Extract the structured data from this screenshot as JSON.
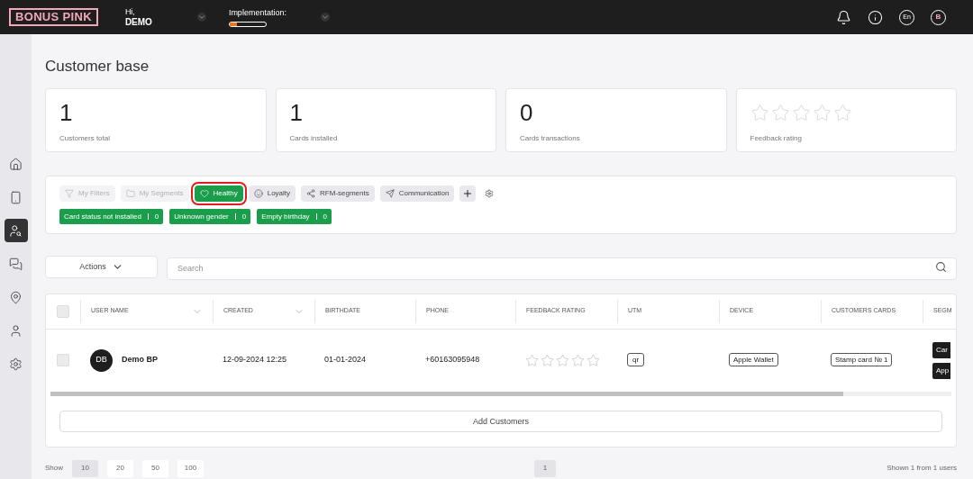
{
  "header": {
    "logo": "BONUS PINK",
    "greeting": "Hi,",
    "user": "DEMO",
    "implementation": {
      "label": "Implementation:",
      "level": 0.2
    },
    "language": "En",
    "avatar": "B"
  },
  "sidebar": {
    "items": [
      {
        "selected": false
      },
      {
        "selected": false
      },
      {
        "selected": true
      },
      {
        "selected": false
      },
      {
        "selected": false
      },
      {
        "selected": false
      },
      {
        "selected": false
      }
    ]
  },
  "page_title": "Customer base",
  "stats": [
    {
      "kind": "number",
      "value": "1",
      "label": "Customers total"
    },
    {
      "kind": "number",
      "value": "1",
      "label": "Cards installed"
    },
    {
      "kind": "number",
      "value": "0",
      "label": "Cards transactions"
    },
    {
      "kind": "stars",
      "stars": 0,
      "label": "Feedback rating"
    }
  ],
  "filter_tabs": [
    {
      "label": "My Filters",
      "selected": false,
      "disabled": true,
      "highlighted": false
    },
    {
      "label": "My Segments",
      "selected": false,
      "disabled": true,
      "highlighted": false
    },
    {
      "label": "Healthy",
      "selected": true,
      "disabled": false,
      "highlighted": true
    },
    {
      "label": "Loyalty",
      "selected": false,
      "disabled": false,
      "highlighted": false
    },
    {
      "label": "RFM-segments",
      "selected": false,
      "disabled": false,
      "highlighted": false
    },
    {
      "label": "Communication",
      "selected": false,
      "disabled": false,
      "highlighted": false
    }
  ],
  "segments": [
    {
      "label": "Card status not installed",
      "count": "0"
    },
    {
      "label": "Unknown gender",
      "count": "0"
    },
    {
      "label": "Empty birthday",
      "count": "0"
    }
  ],
  "actions_button": "Actions",
  "search": {
    "placeholder": "Search"
  },
  "table": {
    "select_all": {
      "checked": false
    },
    "columns": [
      {
        "label": "USER NAME",
        "sortable": true
      },
      {
        "label": "CREATED",
        "sortable": true
      },
      {
        "label": "BIRTHDATE",
        "sortable": false
      },
      {
        "label": "PHONE",
        "sortable": false
      },
      {
        "label": "FEEDBACK RATING",
        "sortable": false
      },
      {
        "label": "UTM",
        "sortable": false
      },
      {
        "label": "DEVICE",
        "sortable": false
      },
      {
        "label": "CUSTOMERS CARDS",
        "sortable": false
      },
      {
        "label": "SEGM"
      }
    ],
    "rows": [
      {
        "checked": false,
        "initials": "DB",
        "name": "Demo BP",
        "created": "12-09-2024 12:25",
        "birthdate": "01-01-2024",
        "phone": "+60163095948",
        "stars": 0,
        "utm": "qr",
        "device": "Apple Wallet",
        "card": "Stamp card № 1",
        "segments": [
          "Car",
          "App"
        ]
      }
    ]
  },
  "add_button": "Add Customers",
  "footer": {
    "show_label": "Show",
    "page_sizes": [
      {
        "label": "10",
        "selected": true
      },
      {
        "label": "20",
        "selected": false
      },
      {
        "label": "50",
        "selected": false
      },
      {
        "label": "100",
        "selected": false
      }
    ],
    "pages": [
      {
        "label": "1",
        "selected": true
      }
    ],
    "summary": "Shown 1 from 1 users"
  }
}
